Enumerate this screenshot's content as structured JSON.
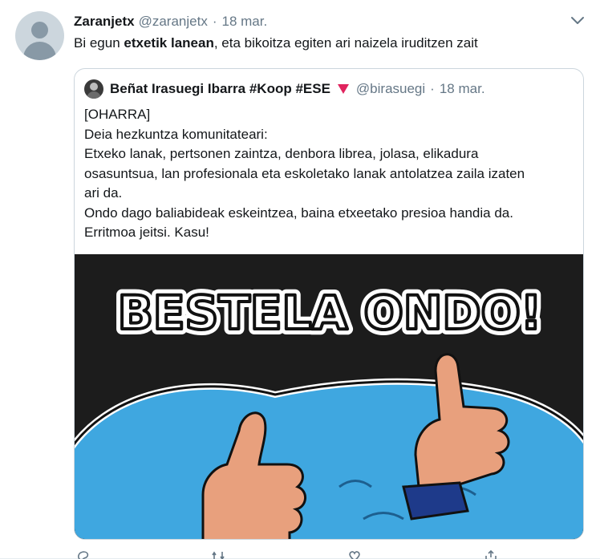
{
  "tweet": {
    "display_name": "Zaranjetx",
    "handle": "@zaranjetx",
    "separator": "·",
    "date": "18 mar.",
    "text_before": "Bi egun ",
    "text_bold": "etxetik lanean",
    "text_after": ", eta bikoitza egiten ari naizela iruditzen zait"
  },
  "quote": {
    "display_name": "Beñat Irasuegi Ibarra #Koop #ESE",
    "handle": "@birasuegi",
    "separator": "·",
    "date": "18 mar.",
    "lines": [
      "[OHARRA]",
      "Deia hezkuntza komunitateari:",
      "Etxeko lanak, pertsonen zaintza, denbora librea, jolasa, elikadura",
      "osasuntsua, lan profesionala eta eskoletako lanak antolatzea zaila izaten",
      "ari da.",
      "Ondo dago baliabideak eskeintzea, baina etxeetako presioa handia da.",
      "Erritmoa jeitsi. Kasu!"
    ],
    "image_text": "BESTELA ONDO!"
  },
  "icons": [
    "chevron-down-icon",
    "red-triangle-icon",
    "reply-icon",
    "retweet-icon",
    "like-icon",
    "share-icon"
  ],
  "colors": {
    "text": "#14171a",
    "muted": "#657786",
    "border": "#ccd6dd",
    "flag_red": "#e0245e",
    "water": "#3fa7e0"
  }
}
